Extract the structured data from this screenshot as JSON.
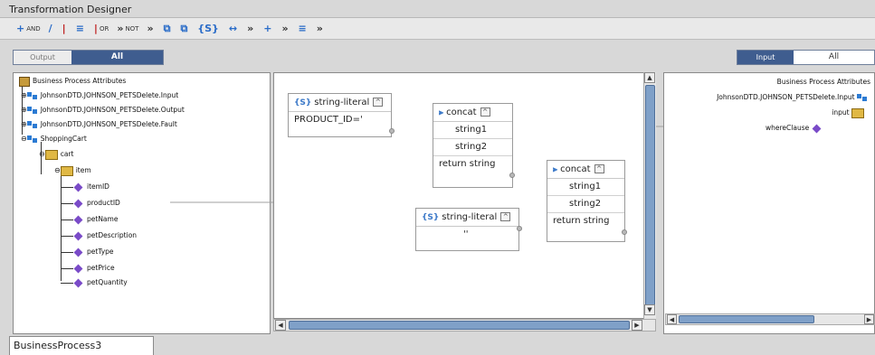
{
  "window": {
    "title": "Transformation Designer"
  },
  "toolbar": {
    "items": [
      {
        "glyph": "+",
        "label": "AND",
        "color": "#2a6cc8"
      },
      {
        "glyph": "/",
        "label": "",
        "color": "#2a6cc8"
      },
      {
        "glyph": "|",
        "label": "",
        "color": "#c02020"
      },
      {
        "glyph": "≡",
        "label": "",
        "color": "#2a6cc8"
      },
      {
        "glyph": "|",
        "label": "OR",
        "color": "#c02020"
      },
      {
        "glyph": "»",
        "label": "NOT",
        "color": "#333333"
      },
      {
        "glyph": "»",
        "label": "",
        "color": "#333333"
      },
      {
        "glyph": "⧉",
        "label": "",
        "color": "#2a6cc8"
      },
      {
        "glyph": "⧉",
        "label": "",
        "color": "#2a6cc8"
      },
      {
        "glyph": "{S}",
        "label": "",
        "color": "#2a6cc8"
      },
      {
        "glyph": "↔",
        "label": "",
        "color": "#2a6cc8"
      },
      {
        "glyph": "»",
        "label": "",
        "color": "#333333"
      },
      {
        "glyph": "+",
        "label": "",
        "color": "#2a6cc8"
      },
      {
        "glyph": "»",
        "label": "",
        "color": "#333333"
      },
      {
        "glyph": "≡",
        "label": "",
        "color": "#2a6cc8"
      },
      {
        "glyph": "»",
        "label": "",
        "color": "#333333"
      }
    ]
  },
  "output_toggle": {
    "output": "Output",
    "all": "All"
  },
  "input_toggle": {
    "input": "Input",
    "all": "All"
  },
  "left_tree": {
    "root": "Business Process Attributes",
    "msg1": "JohnsonDTD.JOHNSON_PETSDelete.Input",
    "msg2": "JohnsonDTD.JOHNSON_PETSDelete.Output",
    "msg3": "JohnsonDTD.JOHNSON_PETSDelete.Fault",
    "cart_root": "ShoppingCart",
    "cart": "cart",
    "item": "item",
    "fields": [
      "itemID",
      "productID",
      "petName",
      "petDescription",
      "petType",
      "petPrice",
      "petQuantity"
    ]
  },
  "canvas": {
    "lit1": {
      "title": "string-literal",
      "value": "PRODUCT_ID='"
    },
    "concat1": {
      "title": "concat",
      "in1": "string1",
      "in2": "string2",
      "out": "return string"
    },
    "lit2": {
      "title": "string-literal",
      "value": "''"
    },
    "concat2": {
      "title": "concat",
      "in1": "string1",
      "in2": "string2",
      "out": "return string"
    },
    "lit_icon": "{S}"
  },
  "right_tree": {
    "root": "Business Process Attributes",
    "msg": "JohnsonDTD.JOHNSON_PETSDelete.Input",
    "input": "input",
    "where": "whereClause"
  },
  "bottom_tab": {
    "label": "BusinessProcess3"
  },
  "colors": {
    "accent": "#3f5d8f",
    "attr_icon": "#7a4bc8",
    "scroll_thumb": "#7fa0c8"
  }
}
